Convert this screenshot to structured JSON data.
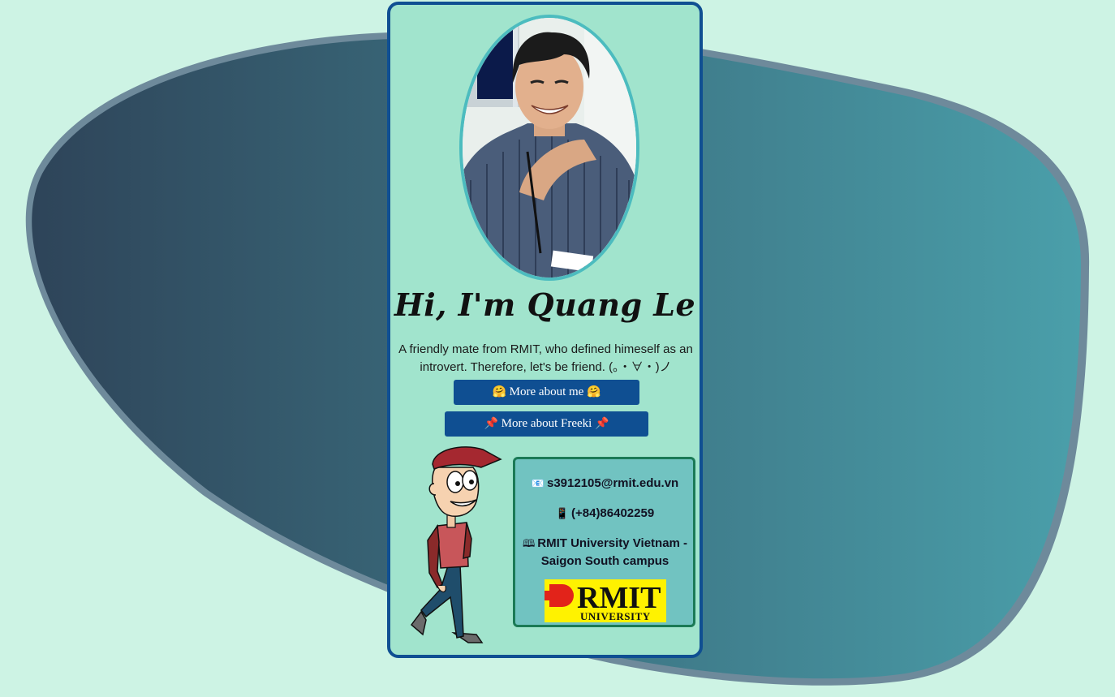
{
  "profile": {
    "greeting": "Hi, I'm Quang Le",
    "intro": "A friendly mate from RMIT, who defined himeself as an introvert. Therefore, let's be friend. (｡・∀・)ノ"
  },
  "buttons": {
    "about_emoji": "🤗",
    "about_label": "More about me",
    "freeki_emoji": "📌",
    "freeki_label": "More about Freeki"
  },
  "contact": {
    "email_icon": "📧",
    "email": "s3912105@rmit.edu.vn",
    "phone_icon": "📱",
    "phone": "(+84)86402259",
    "campus_icon": "🕮",
    "campus": "RMIT University Vietnam - Saigon South campus"
  },
  "logo": {
    "name": "RMIT",
    "subtitle": "UNIVERSITY"
  },
  "colors": {
    "page_background": "#cdf3e4",
    "card_background": "#a1e4cd",
    "card_border": "#0f4f92",
    "button_background": "#0f4f92",
    "contact_background": "#71c3c1",
    "contact_border": "#1b7a56",
    "blob_dark": "#2e4459",
    "blob_light": "#4a9faa",
    "logo_yellow": "#fff200",
    "logo_red": "#e2231a"
  },
  "icons": {
    "portrait": "person-photo",
    "mascot": "cartoon-character",
    "background": "decorative-blob"
  }
}
